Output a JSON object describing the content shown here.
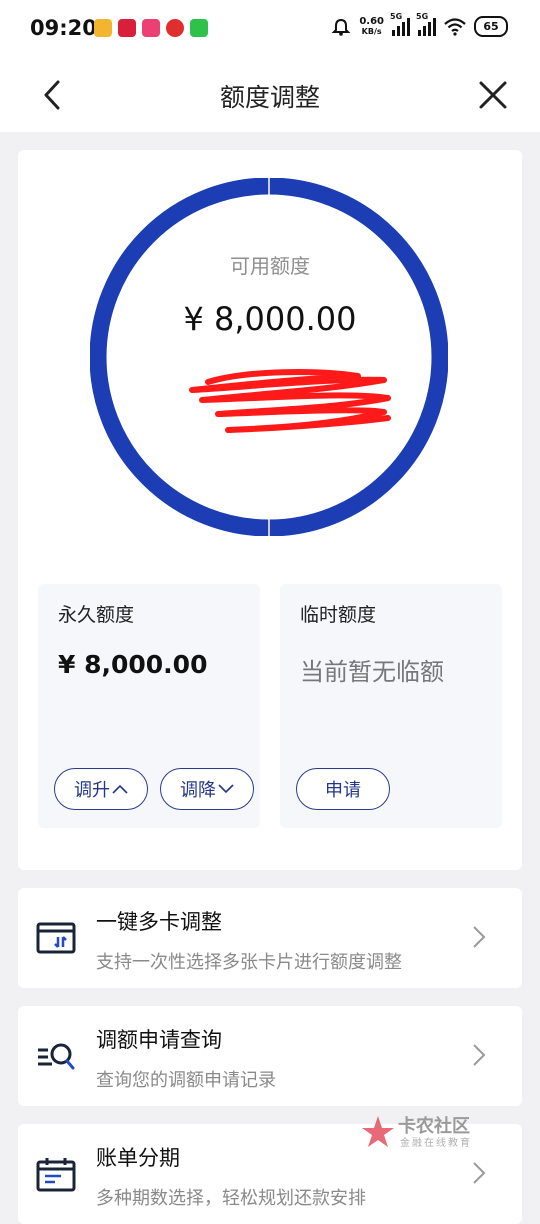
{
  "status_bar": {
    "time": "09:20",
    "net_speed_value": "0.60",
    "net_speed_unit": "KB/s",
    "signal_1_label": "5G",
    "signal_2_label": "5G",
    "battery": "65"
  },
  "nav": {
    "title": "额度调整"
  },
  "credit": {
    "available_label": "可用额度",
    "available_amount": "¥ 8,000.00"
  },
  "permanent_quota": {
    "title": "永久额度",
    "amount": "¥ 8,000.00",
    "raise_label": "调升",
    "lower_label": "调降"
  },
  "temporary_quota": {
    "title": "临时额度",
    "status": "当前暂无临额",
    "apply_label": "申请"
  },
  "menu": [
    {
      "title": "一键多卡调整",
      "subtitle": "支持一次性选择多张卡片进行额度调整"
    },
    {
      "title": "调额申请查询",
      "subtitle": "查询您的调额申请记录"
    },
    {
      "title": "账单分期",
      "subtitle": "多种期数选择，轻松规划还款安排"
    }
  ],
  "watermark": {
    "text": "卡农社区",
    "subtext": "金融在线教育"
  },
  "colors": {
    "ring": "#1c3db3",
    "accent": "#24378a",
    "scribble": "#ff1a1a"
  }
}
